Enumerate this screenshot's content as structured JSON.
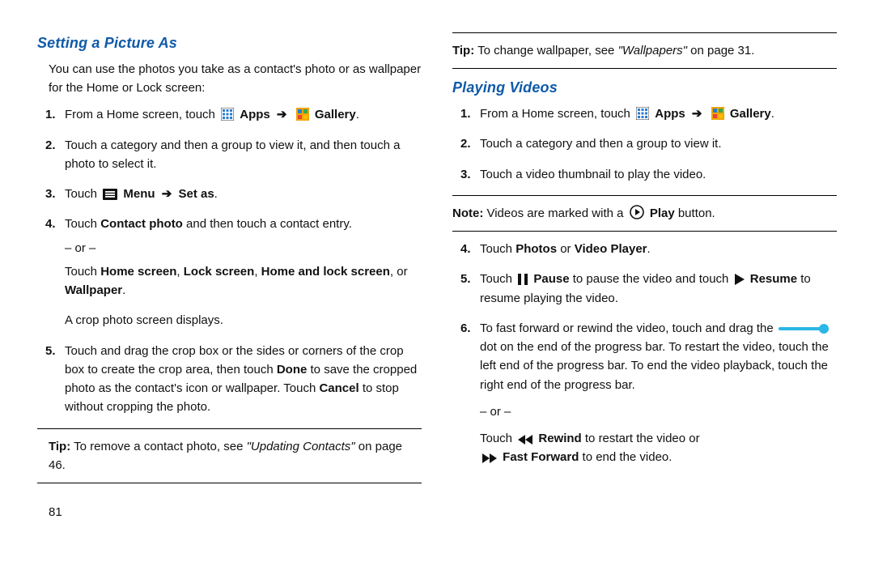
{
  "left": {
    "heading": "Setting a Picture As",
    "intro": "You can use the photos you take as a contact's photo or as wallpaper for the Home or Lock screen:",
    "items": {
      "i1_pre": "From a Home screen, touch ",
      "i1_apps": "Apps",
      "i1_gallery": "Gallery",
      "i2": "Touch a category and then a group to view it, and then touch a photo to select it.",
      "i3_pre": "Touch ",
      "i3_menu": "Menu",
      "i3_setas": "Set as",
      "i4_a": "Touch ",
      "i4_cp": "Contact photo",
      "i4_b": " and then touch a contact entry.",
      "or": "– or –",
      "i4_c1": "Touch ",
      "i4_hs": "Home screen",
      "i4_sep": ", ",
      "i4_ls": "Lock screen",
      "i4_hl": "Home and lock screen",
      "i4_or": ", or ",
      "i4_wp": "Wallpaper",
      "i4_crop": "A crop photo screen displays.",
      "i5_a": "Touch and drag the crop box or the sides or corners of the crop box to create the crop area, then touch ",
      "i5_done": "Done",
      "i5_b": " to save the cropped photo as the contact's icon or wallpaper. Touch ",
      "i5_cancel": "Cancel",
      "i5_c": " to stop without cropping the photo."
    },
    "tip_label": "Tip:",
    "tip_a": " To remove a contact photo, see ",
    "tip_ref": "\"Updating Contacts\"",
    "tip_b": " on page 46.",
    "page_num": "81"
  },
  "right": {
    "top_tip_label": "Tip:",
    "top_tip_a": " To change wallpaper, see ",
    "top_tip_ref": "\"Wallpapers\"",
    "top_tip_b": " on page 31.",
    "heading": "Playing Videos",
    "items": {
      "i1_pre": "From a Home screen, touch ",
      "i1_apps": "Apps",
      "i1_gallery": "Gallery",
      "i2": "Touch a category and then a group to view it.",
      "i3": "Touch a video thumbnail to play the video.",
      "note_label": "Note:",
      "note_a": " Videos are marked with a ",
      "note_play": "Play",
      "note_b": " button.",
      "i4_a": "Touch ",
      "i4_photos": "Photos",
      "i4_or": " or ",
      "i4_vp": "Video Player",
      "i5_a": "Touch ",
      "i5_pause": "Pause",
      "i5_b": " to pause the video and touch ",
      "i5_resume": "Resume",
      "i5_c": " to resume playing the video.",
      "i6_a": "To fast forward or rewind the video, touch and drag the ",
      "i6_b": " dot on the end of the progress bar. To restart the video, touch the left end of the progress bar. To end the video playback, touch the right end of the progress bar.",
      "or": "– or –",
      "i6_c": "Touch ",
      "i6_rew": "Rewind",
      "i6_d": " to restart the video or ",
      "i6_ff": "Fast Forward",
      "i6_e": " to end the video."
    }
  },
  "markers": {
    "m1": "1.",
    "m2": "2.",
    "m3": "3.",
    "m4": "4.",
    "m5": "5.",
    "m6": "6."
  }
}
